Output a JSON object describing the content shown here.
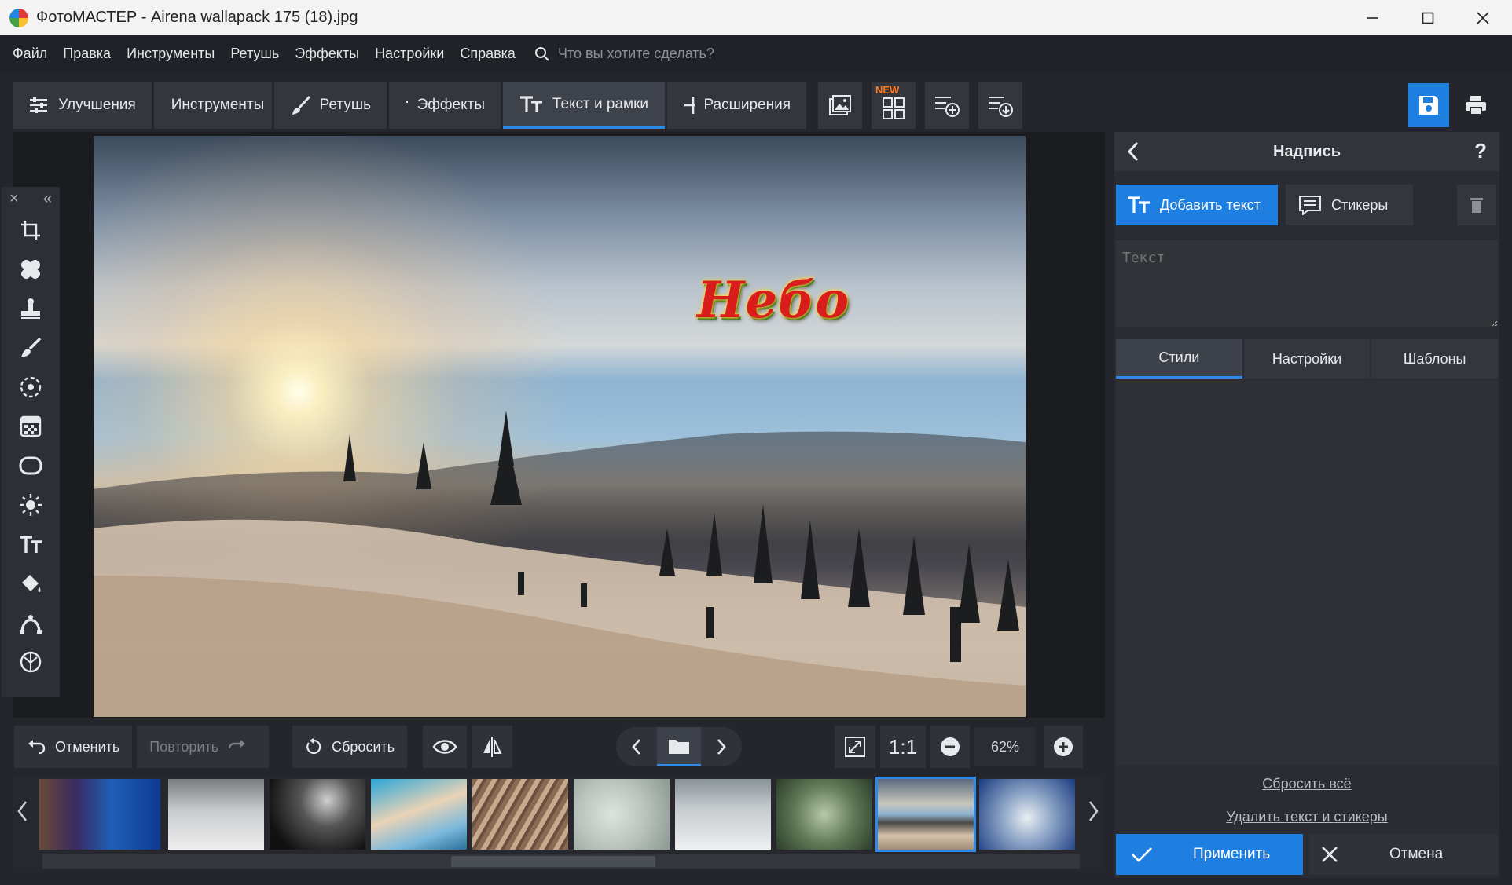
{
  "titlebar": {
    "app": "ФотоМАСТЕР",
    "title": "ФотоМАСТЕР - Airena wallapack 175 (18).jpg"
  },
  "menu": {
    "items": [
      "Файл",
      "Правка",
      "Инструменты",
      "Ретушь",
      "Эффекты",
      "Настройки",
      "Справка"
    ],
    "search_placeholder": "Что вы хотите сделать?"
  },
  "toolbar": {
    "tabs": [
      {
        "label": "Улучшения",
        "icon": "sliders-icon"
      },
      {
        "label": "Инструменты",
        "icon": "crop-icon"
      },
      {
        "label": "Ретушь",
        "icon": "brush-icon"
      },
      {
        "label": "Эффекты",
        "icon": "sparkle-icon"
      },
      {
        "label": "Текст и рамки",
        "icon": "text-icon",
        "active": true
      },
      {
        "label": "Расширения",
        "icon": "plus-icon"
      }
    ],
    "new_badge": "NEW"
  },
  "canvas": {
    "overlay_text": "Небо"
  },
  "bottom": {
    "undo": "Отменить",
    "redo": "Повторить",
    "reset": "Сбросить",
    "one_to_one": "1:1",
    "zoom": "62%"
  },
  "panel": {
    "title": "Надпись",
    "help": "?",
    "add_text": "Добавить текст",
    "stickers": "Стикеры",
    "text_placeholder": "Текст",
    "tabs": [
      "Стили",
      "Настройки",
      "Шаблоны"
    ],
    "reset_all": "Сбросить всё",
    "delete_all": "Удалить текст и стикеры",
    "apply": "Применить",
    "cancel": "Отмена"
  },
  "colors": {
    "accent": "#1f7fe0",
    "bg": "#24262b",
    "panel": "#2a2c31"
  }
}
